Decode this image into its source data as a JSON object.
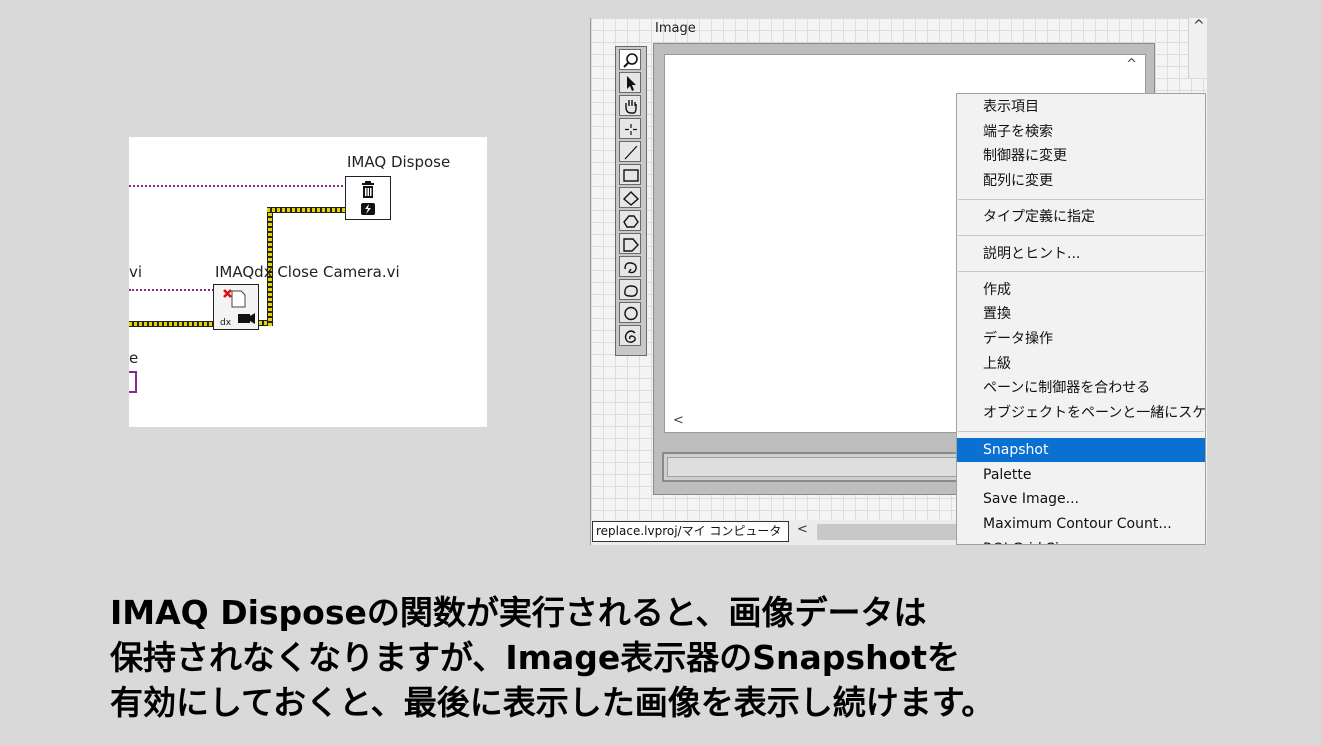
{
  "block_diagram": {
    "imaq_dispose_label": "IMAQ Dispose",
    "close_camera_label": "IMAQdx Close Camera.vi",
    "partial_vi_label": "vi",
    "partial_e_label": "e",
    "close_icon_text": "dx"
  },
  "front_panel": {
    "image_label": "Image",
    "path_text": "replace.lvproj/マイ コンピュータ",
    "scroll_up_glyph": "^",
    "scroll_left_glyph": "<"
  },
  "tools_palette": [
    "zoom-tool",
    "pointer-tool",
    "pan-tool",
    "point-tool",
    "line-tool",
    "rectangle-tool",
    "rotated-rectangle-tool",
    "polygon-tool",
    "freehand-region-tool",
    "annulus-tool",
    "freehand-line-tool",
    "oval-tool",
    "broken-line-tool"
  ],
  "context_menu": {
    "groups": [
      [
        "表示項目",
        "端子を検索",
        "制御器に変更",
        "配列に変更"
      ],
      [
        "タイプ定義に指定"
      ],
      [
        "説明とヒント..."
      ],
      [
        "作成",
        "置換",
        "データ操作",
        "上級",
        "ペーンに制御器を合わせる",
        "オブジェクトをペーンと一緒にスケール"
      ],
      [
        "Snapshot",
        "Palette",
        "Save Image...",
        "Maximum Contour Count...",
        "ROI Grid Size..."
      ]
    ],
    "highlighted": "Snapshot",
    "highlight_color": "#0a70d2"
  },
  "caption": {
    "line1": "IMAQ Disposeの関数が実行されると、画像データは",
    "line2": "保持されなくなりますが、Image表示器のSnapshotを",
    "line3": "有効にしておくと、最後に表示した画像を表示し続けます。"
  }
}
